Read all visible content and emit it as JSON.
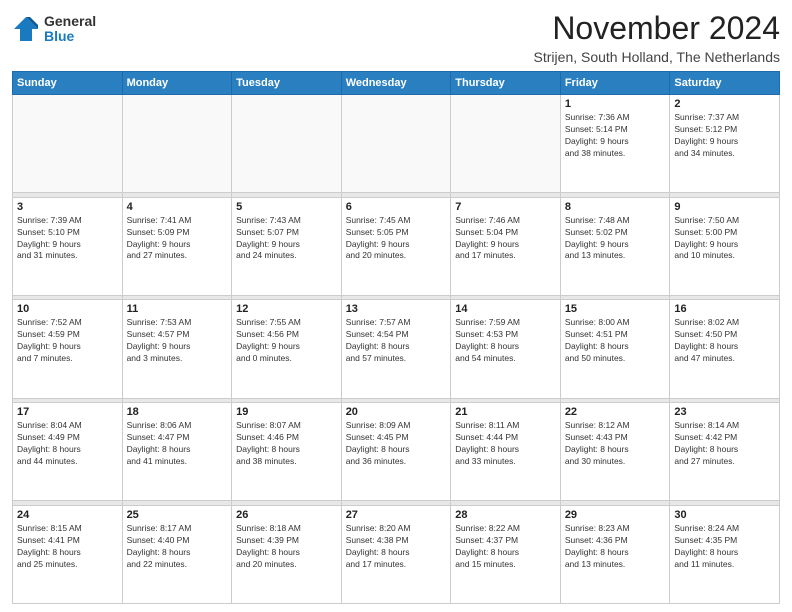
{
  "logo": {
    "general": "General",
    "blue": "Blue"
  },
  "title": "November 2024",
  "location": "Strijen, South Holland, The Netherlands",
  "headers": [
    "Sunday",
    "Monday",
    "Tuesday",
    "Wednesday",
    "Thursday",
    "Friday",
    "Saturday"
  ],
  "weeks": [
    [
      {
        "day": "",
        "info": ""
      },
      {
        "day": "",
        "info": ""
      },
      {
        "day": "",
        "info": ""
      },
      {
        "day": "",
        "info": ""
      },
      {
        "day": "",
        "info": ""
      },
      {
        "day": "1",
        "info": "Sunrise: 7:36 AM\nSunset: 5:14 PM\nDaylight: 9 hours\nand 38 minutes."
      },
      {
        "day": "2",
        "info": "Sunrise: 7:37 AM\nSunset: 5:12 PM\nDaylight: 9 hours\nand 34 minutes."
      }
    ],
    [
      {
        "day": "3",
        "info": "Sunrise: 7:39 AM\nSunset: 5:10 PM\nDaylight: 9 hours\nand 31 minutes."
      },
      {
        "day": "4",
        "info": "Sunrise: 7:41 AM\nSunset: 5:09 PM\nDaylight: 9 hours\nand 27 minutes."
      },
      {
        "day": "5",
        "info": "Sunrise: 7:43 AM\nSunset: 5:07 PM\nDaylight: 9 hours\nand 24 minutes."
      },
      {
        "day": "6",
        "info": "Sunrise: 7:45 AM\nSunset: 5:05 PM\nDaylight: 9 hours\nand 20 minutes."
      },
      {
        "day": "7",
        "info": "Sunrise: 7:46 AM\nSunset: 5:04 PM\nDaylight: 9 hours\nand 17 minutes."
      },
      {
        "day": "8",
        "info": "Sunrise: 7:48 AM\nSunset: 5:02 PM\nDaylight: 9 hours\nand 13 minutes."
      },
      {
        "day": "9",
        "info": "Sunrise: 7:50 AM\nSunset: 5:00 PM\nDaylight: 9 hours\nand 10 minutes."
      }
    ],
    [
      {
        "day": "10",
        "info": "Sunrise: 7:52 AM\nSunset: 4:59 PM\nDaylight: 9 hours\nand 7 minutes."
      },
      {
        "day": "11",
        "info": "Sunrise: 7:53 AM\nSunset: 4:57 PM\nDaylight: 9 hours\nand 3 minutes."
      },
      {
        "day": "12",
        "info": "Sunrise: 7:55 AM\nSunset: 4:56 PM\nDaylight: 9 hours\nand 0 minutes."
      },
      {
        "day": "13",
        "info": "Sunrise: 7:57 AM\nSunset: 4:54 PM\nDaylight: 8 hours\nand 57 minutes."
      },
      {
        "day": "14",
        "info": "Sunrise: 7:59 AM\nSunset: 4:53 PM\nDaylight: 8 hours\nand 54 minutes."
      },
      {
        "day": "15",
        "info": "Sunrise: 8:00 AM\nSunset: 4:51 PM\nDaylight: 8 hours\nand 50 minutes."
      },
      {
        "day": "16",
        "info": "Sunrise: 8:02 AM\nSunset: 4:50 PM\nDaylight: 8 hours\nand 47 minutes."
      }
    ],
    [
      {
        "day": "17",
        "info": "Sunrise: 8:04 AM\nSunset: 4:49 PM\nDaylight: 8 hours\nand 44 minutes."
      },
      {
        "day": "18",
        "info": "Sunrise: 8:06 AM\nSunset: 4:47 PM\nDaylight: 8 hours\nand 41 minutes."
      },
      {
        "day": "19",
        "info": "Sunrise: 8:07 AM\nSunset: 4:46 PM\nDaylight: 8 hours\nand 38 minutes."
      },
      {
        "day": "20",
        "info": "Sunrise: 8:09 AM\nSunset: 4:45 PM\nDaylight: 8 hours\nand 36 minutes."
      },
      {
        "day": "21",
        "info": "Sunrise: 8:11 AM\nSunset: 4:44 PM\nDaylight: 8 hours\nand 33 minutes."
      },
      {
        "day": "22",
        "info": "Sunrise: 8:12 AM\nSunset: 4:43 PM\nDaylight: 8 hours\nand 30 minutes."
      },
      {
        "day": "23",
        "info": "Sunrise: 8:14 AM\nSunset: 4:42 PM\nDaylight: 8 hours\nand 27 minutes."
      }
    ],
    [
      {
        "day": "24",
        "info": "Sunrise: 8:15 AM\nSunset: 4:41 PM\nDaylight: 8 hours\nand 25 minutes."
      },
      {
        "day": "25",
        "info": "Sunrise: 8:17 AM\nSunset: 4:40 PM\nDaylight: 8 hours\nand 22 minutes."
      },
      {
        "day": "26",
        "info": "Sunrise: 8:18 AM\nSunset: 4:39 PM\nDaylight: 8 hours\nand 20 minutes."
      },
      {
        "day": "27",
        "info": "Sunrise: 8:20 AM\nSunset: 4:38 PM\nDaylight: 8 hours\nand 17 minutes."
      },
      {
        "day": "28",
        "info": "Sunrise: 8:22 AM\nSunset: 4:37 PM\nDaylight: 8 hours\nand 15 minutes."
      },
      {
        "day": "29",
        "info": "Sunrise: 8:23 AM\nSunset: 4:36 PM\nDaylight: 8 hours\nand 13 minutes."
      },
      {
        "day": "30",
        "info": "Sunrise: 8:24 AM\nSunset: 4:35 PM\nDaylight: 8 hours\nand 11 minutes."
      }
    ]
  ]
}
